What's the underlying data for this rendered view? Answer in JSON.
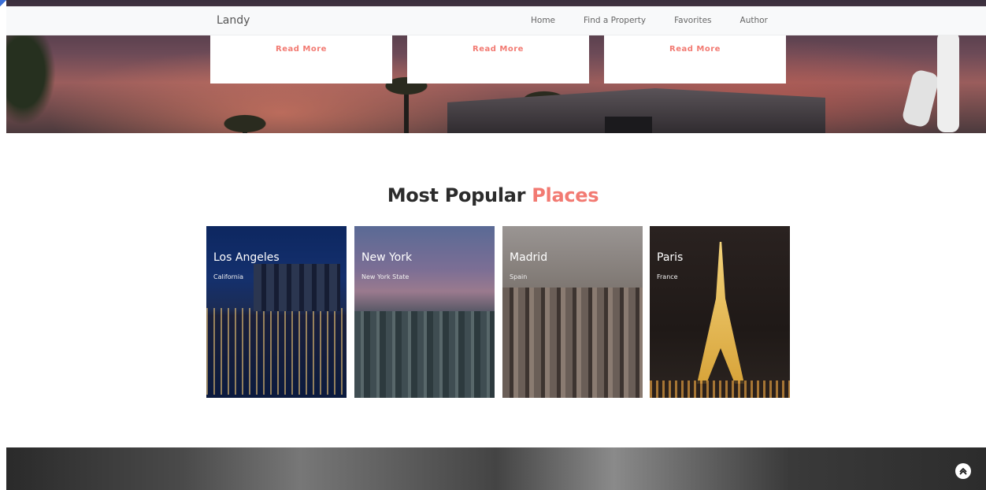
{
  "navbar": {
    "brand": "Landy",
    "links": [
      "Home",
      "Find a Property",
      "Favorites",
      "Author"
    ]
  },
  "hero_cards": [
    {
      "link": "Read More"
    },
    {
      "link": "Read More"
    },
    {
      "link": "Read More"
    }
  ],
  "popular": {
    "title_main": "Most Popular",
    "title_accent": "Places",
    "places": [
      {
        "city": "Los Angeles",
        "region": "California"
      },
      {
        "city": "New York",
        "region": "New York State"
      },
      {
        "city": "Madrid",
        "region": "Spain"
      },
      {
        "city": "Paris",
        "region": "France"
      }
    ]
  },
  "colors": {
    "accent": "#f27a72",
    "navbar_bg": "#f8f9fa",
    "title_text": "#2b2b2b"
  },
  "icons": {
    "scroll_top": "double-chevron-up-icon"
  }
}
